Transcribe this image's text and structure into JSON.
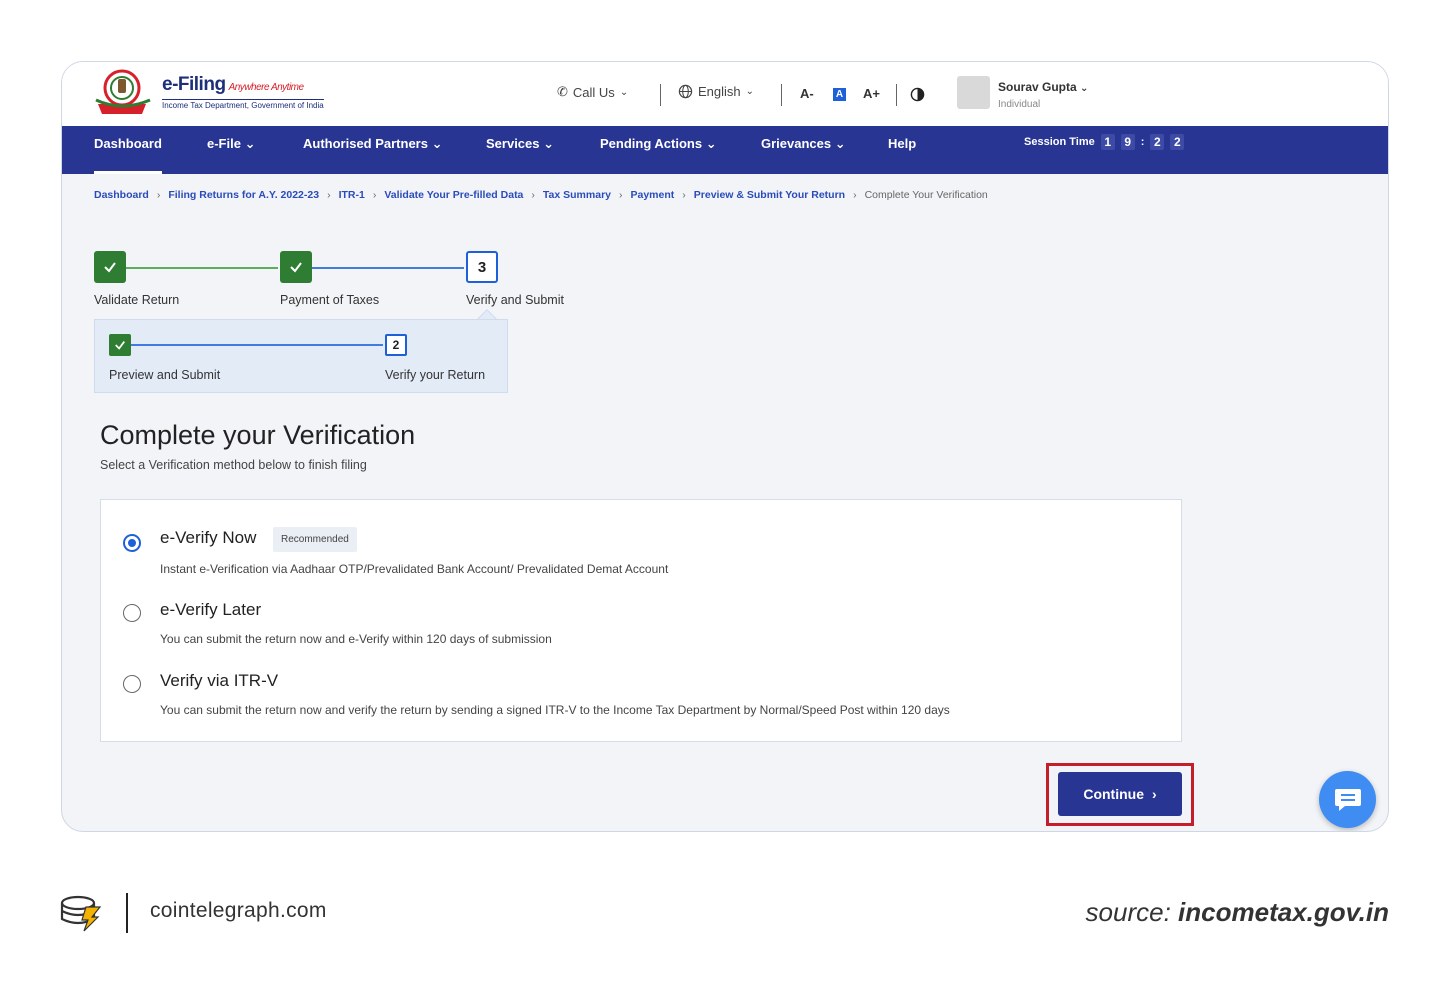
{
  "header": {
    "brand": "e-Filing",
    "tagline": "Anywhere Anytime",
    "subtitle": "Income Tax Department, Government of India",
    "call_us": "Call Us",
    "language": "English",
    "font_decrease": "A-",
    "font_normal": "A",
    "font_increase": "A+",
    "user_name": "Sourav Gupta",
    "user_role": "Individual"
  },
  "nav": {
    "items": [
      "Dashboard",
      "e-File",
      "Authorised Partners",
      "Services",
      "Pending Actions",
      "Grievances",
      "Help"
    ],
    "session_label": "Session Time",
    "session_digits": [
      "1",
      "9",
      "2",
      "2"
    ]
  },
  "breadcrumb": [
    "Dashboard",
    "Filing Returns for A.Y. 2022-23",
    "ITR-1",
    "Validate Your Pre-filled Data",
    "Tax Summary",
    "Payment",
    "Preview & Submit Your Return",
    "Complete Your Verification"
  ],
  "stepper": {
    "steps": [
      "Validate Return",
      "Payment of Taxes",
      "Verify and Submit"
    ],
    "current_number": "3",
    "substeps": [
      "Preview and Submit",
      "Verify your Return"
    ],
    "sub_current_number": "2"
  },
  "page": {
    "title": "Complete your Verification",
    "subtitle": "Select a Verification method below to finish filing"
  },
  "options": [
    {
      "title": "e-Verify Now",
      "badge": "Recommended",
      "desc": "Instant e-Verification via Aadhaar OTP/Prevalidated Bank Account/ Prevalidated Demat Account",
      "selected": true
    },
    {
      "title": "e-Verify Later",
      "desc": "You can submit the return now and e-Verify within 120 days of submission",
      "selected": false
    },
    {
      "title": "Verify via ITR-V",
      "desc": "You can submit the return now and verify the return by sending a signed ITR-V to the Income Tax Department by Normal/Speed Post within 120 days",
      "selected": false
    }
  ],
  "continue_label": "Continue",
  "footer": {
    "site": "cointelegraph.com",
    "source_label": "source:",
    "source_site": "incometax.gov.in"
  },
  "colors": {
    "nav_bg": "#283593",
    "accent": "#1d60d9",
    "done_green": "#2e7d32",
    "highlight_red": "#c41e2a"
  }
}
